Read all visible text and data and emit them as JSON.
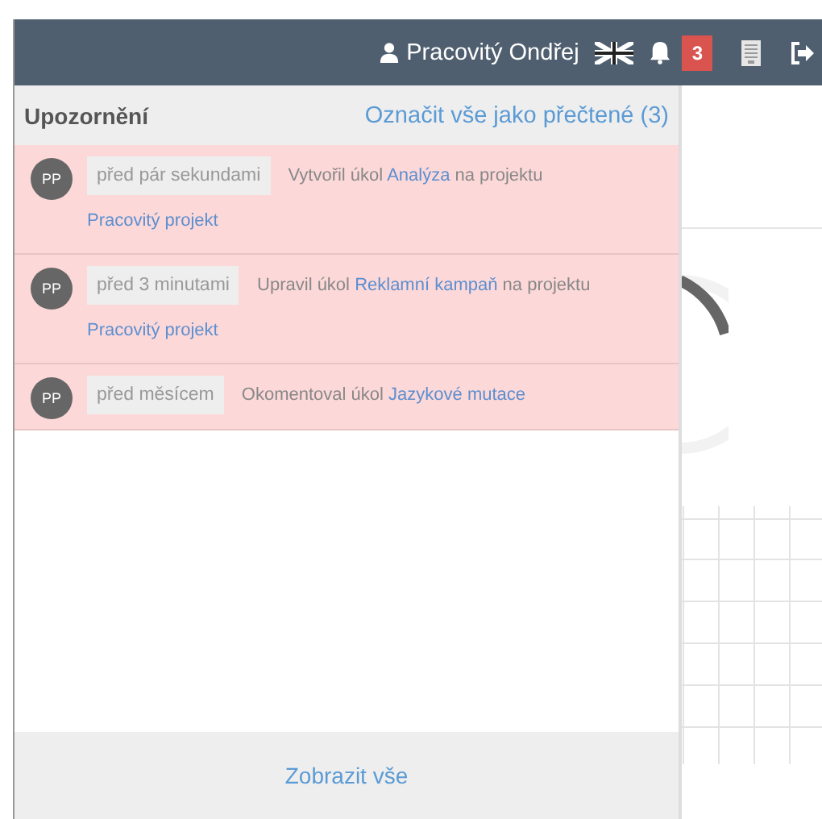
{
  "navbar": {
    "user": "Pracovitý Ondřej",
    "badge": "3"
  },
  "notifications": {
    "title": "Upozornění",
    "mark_all": "Označit vše jako přečtené (3)",
    "items": [
      {
        "avatar": "PP",
        "time": "před pár sekundami",
        "unread": true,
        "parts": [
          {
            "kind": "text",
            "text": "Vytvořil úkol"
          },
          {
            "kind": "link",
            "text": "Analýza"
          },
          {
            "kind": "text",
            "text": "na projektu"
          },
          {
            "kind": "link",
            "text": "Pracovitý projekt"
          }
        ]
      },
      {
        "avatar": "PP",
        "time": "před 3 minutami",
        "unread": true,
        "parts": [
          {
            "kind": "text",
            "text": "Upravil úkol"
          },
          {
            "kind": "link",
            "text": "Reklamní kampaň"
          },
          {
            "kind": "text",
            "text": "na projektu"
          },
          {
            "kind": "link",
            "text": "Pracovitý projekt"
          }
        ]
      },
      {
        "avatar": "PP",
        "time": "před měsícem",
        "unread": true,
        "parts": [
          {
            "kind": "text",
            "text": "Okomentoval úkol"
          },
          {
            "kind": "link",
            "text": "Jazykové mutace"
          }
        ]
      }
    ],
    "footer": "Zobrazit vše"
  }
}
